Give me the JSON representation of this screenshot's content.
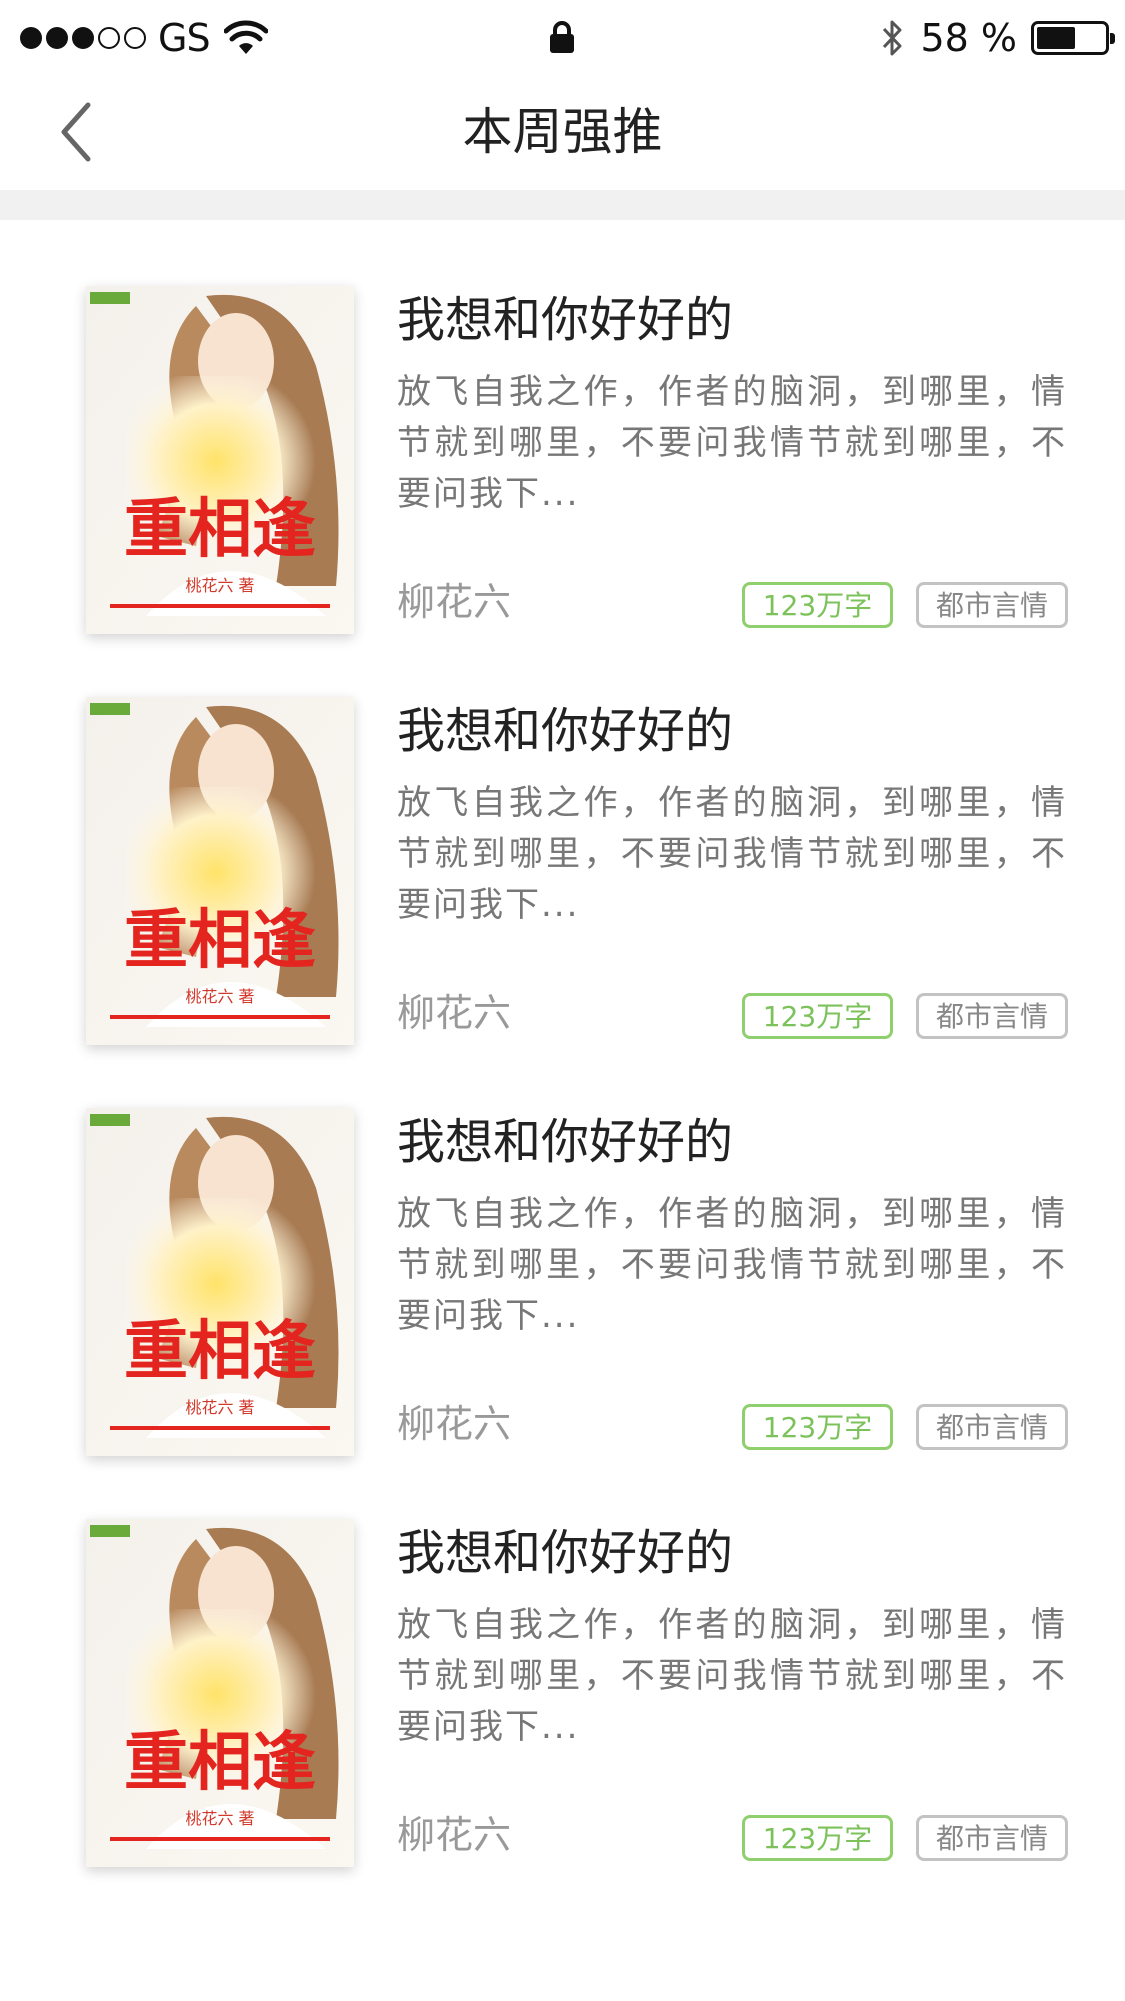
{
  "status_bar": {
    "carrier": "GS",
    "signal_full": 3,
    "signal_total": 5,
    "battery_text": "58 %",
    "battery_level": 0.58
  },
  "nav": {
    "title": "本周强推"
  },
  "colors": {
    "accent_green": "#7cc25a",
    "tag_gray": "#888888",
    "title_text": "#222222",
    "desc_text": "#777777",
    "author_text": "#999999"
  },
  "books": [
    {
      "title": "我想和你好好的",
      "description": "放飞自我之作，作者的脑洞，到哪里，情节就到哪里，不要问我情节就到哪里，不要问我下...",
      "author": "柳花六",
      "word_count": "123万字",
      "genre": "都市言情",
      "cover": {
        "title": "重相逢",
        "author": "桃花六 著"
      }
    },
    {
      "title": "我想和你好好的",
      "description": "放飞自我之作，作者的脑洞，到哪里，情节就到哪里，不要问我情节就到哪里，不要问我下...",
      "author": "柳花六",
      "word_count": "123万字",
      "genre": "都市言情",
      "cover": {
        "title": "重相逢",
        "author": "桃花六 著"
      }
    },
    {
      "title": "我想和你好好的",
      "description": "放飞自我之作，作者的脑洞，到哪里，情节就到哪里，不要问我情节就到哪里，不要问我下...",
      "author": "柳花六",
      "word_count": "123万字",
      "genre": "都市言情",
      "cover": {
        "title": "重相逢",
        "author": "桃花六 著"
      }
    },
    {
      "title": "我想和你好好的",
      "description": "放飞自我之作，作者的脑洞，到哪里，情节就到哪里，不要问我情节就到哪里，不要问我下...",
      "author": "柳花六",
      "word_count": "123万字",
      "genre": "都市言情",
      "cover": {
        "title": "重相逢",
        "author": "桃花六 著"
      }
    }
  ]
}
